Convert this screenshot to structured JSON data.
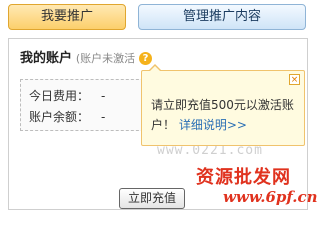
{
  "tabs": [
    {
      "label": "我要推广",
      "active": true
    },
    {
      "label": "管理推广内容",
      "active": false
    }
  ],
  "account": {
    "title": "我的账户",
    "status": "(账户未激活",
    "help_icon": "?",
    "today_cost_label": "今日费用：",
    "today_cost_value": "-",
    "balance_label": "账户余额：",
    "balance_value": "-"
  },
  "tooltip": {
    "close_icon": "×",
    "message": "请立即充值500元以激活账户！",
    "link": "详细说明>>"
  },
  "recharge_button": "立即充值",
  "watermarks": {
    "url": "www.0221.com",
    "brand": "资源批发网",
    "domain": "www.6pf.cn"
  },
  "colors": {
    "tab_active": "#fccf6b",
    "tab_inactive": "#cfe4f7",
    "tooltip_bg": "#fffbe0",
    "link": "#2a6fb5",
    "brand_red": "#e0321e"
  }
}
